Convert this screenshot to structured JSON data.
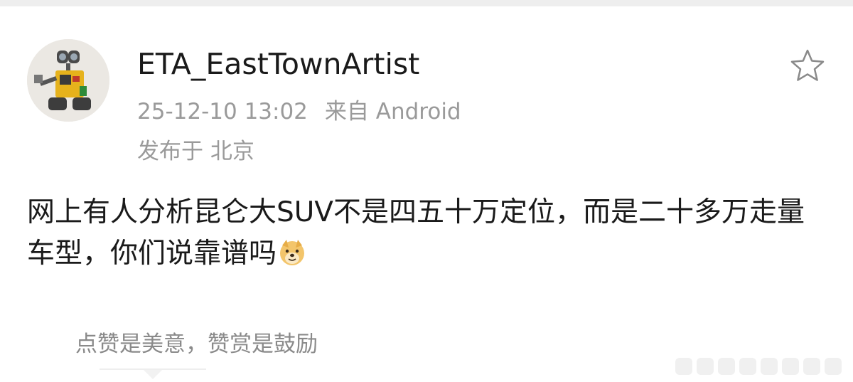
{
  "post": {
    "username": "ETA_EastTownArtist",
    "timestamp": "25-12-10 13:02",
    "source": "来自 Android",
    "location": "发布于 北京",
    "content": "网上有人分析昆仑大SUV不是四五十万定位，而是二十多万走量车型，你们说靠谱吗",
    "content_emoji": "doge-emoji"
  },
  "reward": {
    "text": "点赞是美意，赞赏是鼓励"
  },
  "icons": {
    "avatar": "robot-avatar",
    "favorite": "star-icon",
    "pager": "dots-pager"
  },
  "colors": {
    "text_primary": "#1a1a1a",
    "text_secondary": "#9a9a9a",
    "background": "#ffffff",
    "top_bar": "#eeeeee"
  }
}
